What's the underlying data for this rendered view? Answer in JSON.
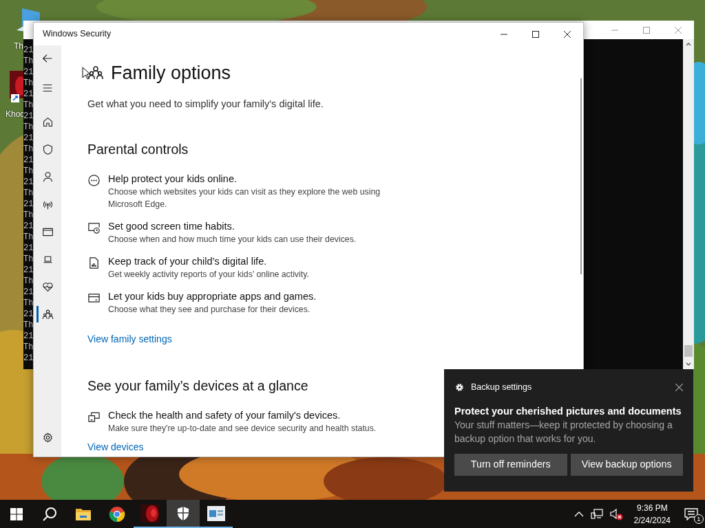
{
  "desktop_icons": [
    {
      "label": "Th",
      "kind": "monitor"
    },
    {
      "label": "Khoc",
      "kind": "shortcut"
    }
  ],
  "console": {
    "lines": [
      "21",
      "Th",
      "21",
      "Th",
      "21",
      "Th",
      "21",
      "Th",
      "21",
      "Th",
      "21",
      "Th",
      "21",
      "Th",
      "21",
      "Th",
      "21",
      "Th",
      "21",
      "Th",
      "21",
      "Th",
      "21",
      "Th",
      "21",
      "Th",
      "21",
      "Th",
      "21"
    ]
  },
  "security_window": {
    "title": "Windows Security",
    "nav": [
      {
        "kind": "back",
        "selected": false
      },
      {
        "kind": "menu",
        "selected": false
      },
      {
        "kind": "home",
        "selected": false
      },
      {
        "kind": "shield",
        "selected": false
      },
      {
        "kind": "person",
        "selected": false
      },
      {
        "kind": "wireless",
        "selected": false
      },
      {
        "kind": "window",
        "selected": false
      },
      {
        "kind": "laptop",
        "selected": false
      },
      {
        "kind": "heart",
        "selected": false
      },
      {
        "kind": "family",
        "selected": true
      }
    ],
    "page": {
      "title": "Family options",
      "subtitle": "Get what you need to simplify your family's digital life.",
      "sections": [
        {
          "heading": "Parental controls",
          "items": [
            {
              "kind": "web",
              "title": "Help protect your kids online.",
              "description": "Choose which websites your kids can visit as they explore the web using Microsoft Edge."
            },
            {
              "kind": "screen-time",
              "title": "Set good screen time habits.",
              "description": "Choose when and how much time your kids can use their devices."
            },
            {
              "kind": "report",
              "title": "Keep track of your child’s digital life.",
              "description": "Get weekly activity reports of your kids’ online activity."
            },
            {
              "kind": "card",
              "title": "Let your kids buy appropriate apps and games.",
              "description": "Choose what they see and purchase for their devices."
            }
          ],
          "link": "View family settings"
        },
        {
          "heading": "See your family’s devices at a glance",
          "items": [
            {
              "kind": "devices",
              "title": "Check the health and safety of your family's devices.",
              "description": "Make sure they're up-to-date and see device security and health status."
            }
          ],
          "link": "View devices"
        }
      ]
    }
  },
  "notification": {
    "app": "Backup settings",
    "title": "Protect your cherished pictures and documents",
    "body": "Your stuff matters—keep it protected by choosing a backup option that works for you.",
    "buttons": [
      "Turn off reminders",
      "View backup options"
    ]
  },
  "taskbar": {
    "apps": [
      {
        "kind": "folder",
        "running": false,
        "selected": false
      },
      {
        "kind": "browser",
        "running": false,
        "selected": false
      },
      {
        "kind": "red-app",
        "running": true,
        "selected": false
      },
      {
        "kind": "shield",
        "running": true,
        "selected": true
      },
      {
        "kind": "window-app",
        "running": true,
        "selected": false
      }
    ],
    "clock": {
      "time": "9:36 PM",
      "date": "2/24/2024"
    },
    "notification_count": "1"
  }
}
